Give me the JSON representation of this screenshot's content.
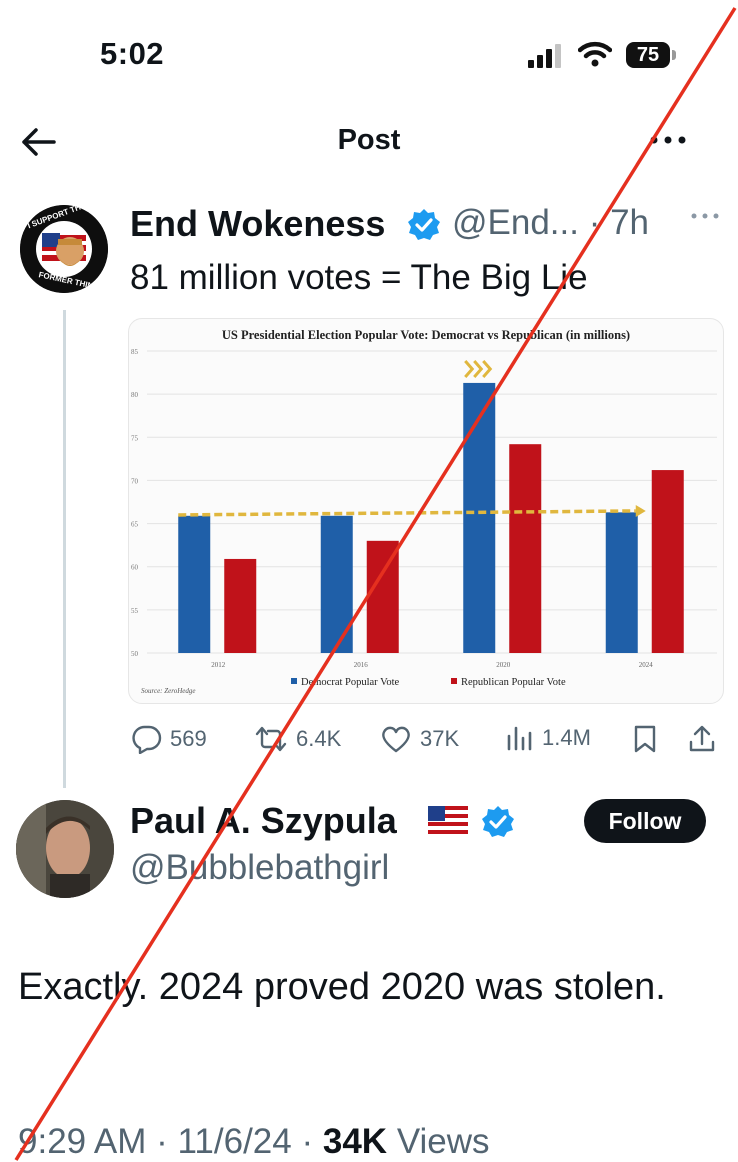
{
  "status_bar": {
    "time": "5:02",
    "battery": "75"
  },
  "header": {
    "title": "Post"
  },
  "tweet1": {
    "author_name": "End Wokeness",
    "handle_time": "@End... · 7h",
    "text": "81 million votes = The Big Lie",
    "avatar_label_top": "I SUPPORT THE",
    "avatar_label_bottom": "FORMER THINGS",
    "actions": {
      "replies": "569",
      "reposts": "6.4K",
      "likes": "37K",
      "views": "1.4M"
    }
  },
  "tweet2": {
    "author_name": "Paul A. Szypula",
    "handle": "@Bubblebathgirl",
    "follow_label": "Follow",
    "text": "Exactly. 2024 proved 2020 was stolen.",
    "time": "9:29 AM",
    "date": "11/6/24",
    "views_count": "34K",
    "views_label": "Views"
  },
  "colors": {
    "accent": "#1d9bf0",
    "democrat": "#1f5fa8",
    "republican": "#c0121a",
    "slash": "#e5301f"
  },
  "chart_data": {
    "type": "bar",
    "title": "US Presidential Election Popular Vote: Democrat vs Republican (in millions)",
    "categories": [
      "2012",
      "2016",
      "2020",
      "2024"
    ],
    "series": [
      {
        "name": "Democrat Popular Vote",
        "color": "#1f5fa8",
        "values": [
          65.9,
          65.9,
          81.3,
          66.3
        ]
      },
      {
        "name": "Republican Popular Vote",
        "color": "#c0121a",
        "values": [
          60.9,
          63.0,
          74.2,
          71.2
        ]
      }
    ],
    "ylim": [
      50,
      85
    ],
    "yticks": [
      "50",
      "55",
      "60",
      "65",
      "70",
      "75",
      "80",
      "85"
    ],
    "source": "Source: ZeroHedge",
    "annotation": "dashed gold arrow at ~66M from 2012 to 2024",
    "legend_position": "bottom"
  }
}
